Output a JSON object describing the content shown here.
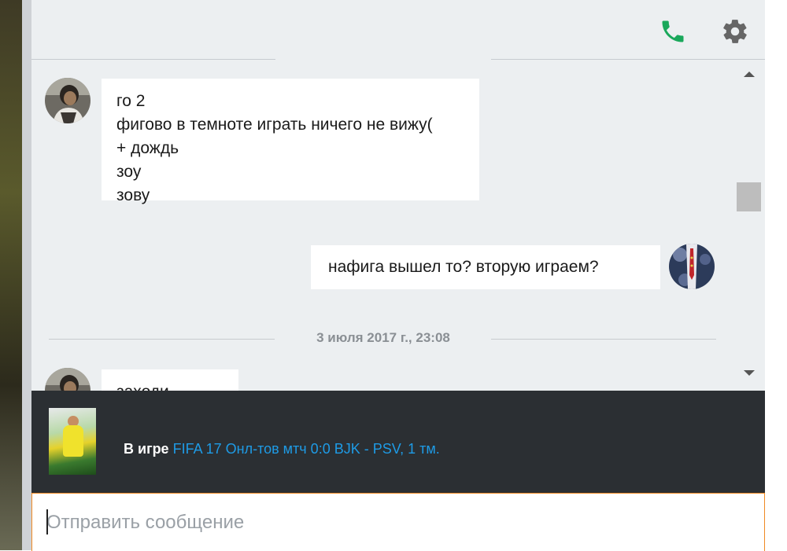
{
  "header": {
    "call_icon": "phone-icon",
    "settings_icon": "gear-icon"
  },
  "messages": [
    {
      "direction": "incoming",
      "lines": [
        "го 2",
        "фигово в темноте играть ничего не вижу(",
        "+ дождь",
        "зоу",
        "зову"
      ]
    },
    {
      "direction": "outgoing",
      "lines": [
        "нафига вышел то? вторую играем?"
      ]
    },
    {
      "direction": "incoming",
      "lines": [
        "заходи"
      ]
    }
  ],
  "date_separator": "3 июля 2017 г., 23:08",
  "game_status": {
    "label": "В игре",
    "value": "FIFA 17 Онл-тов мтч 0:0 BJK - PSV, 1 тм."
  },
  "composer": {
    "placeholder": "Отправить сообщение"
  },
  "colors": {
    "accent_green": "#1aa85b",
    "link_blue": "#1e9be6",
    "input_border": "#f08a24",
    "game_bar_bg": "#2b2f33",
    "chat_bg": "#eceff1"
  }
}
